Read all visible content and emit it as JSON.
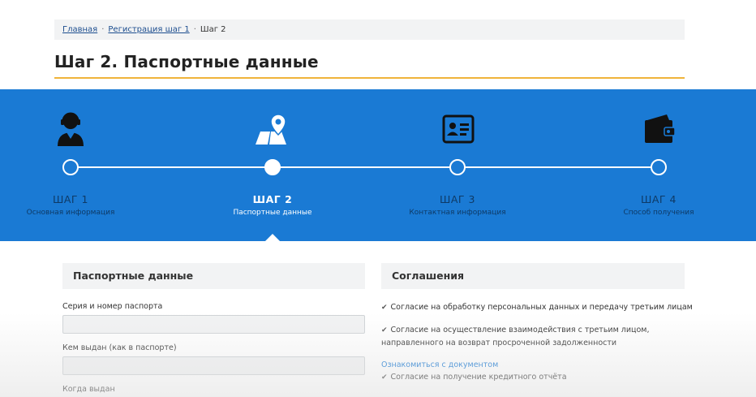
{
  "breadcrumb": {
    "home": "Главная",
    "sep": "·",
    "step1": "Регистрация шаг 1",
    "current": "Шаг 2"
  },
  "page": {
    "title": "Шаг 2. Паспортные данные"
  },
  "steps": [
    {
      "num": "ШАГ 1",
      "label": "Основная информация",
      "icon": "user-operator-icon",
      "active": false
    },
    {
      "num": "ШАГ 2",
      "label": "Паспортные данные",
      "icon": "map-pin-icon",
      "active": true
    },
    {
      "num": "ШАГ 3",
      "label": "Контактная информация",
      "icon": "id-card-icon",
      "active": false
    },
    {
      "num": "ШАГ 4",
      "label": "Способ получения",
      "icon": "wallet-icon",
      "active": false
    }
  ],
  "passport": {
    "heading": "Паспортные данные",
    "series_label": "Серия и номер паспорта",
    "issued_by_label": "Кем выдан (как в паспорте)",
    "issued_when_label": "Когда выдан"
  },
  "agreements": {
    "heading": "Соглашения",
    "consent1": "Согласие на обработку персональных данных и передачу третьим лицам",
    "consent2_line1": "Согласие на осуществление взаимодействия с третьим лицом,",
    "consent2_line2": "направленного на возврат просроченной задолженности",
    "doc_link": "Ознакомиться с документом",
    "consent3": "Согласие на получение кредитного отчёта"
  },
  "colors": {
    "accent": "#1a7ad4",
    "title_underline": "#f0b43a",
    "inactive_step_text": "#0e3a66"
  }
}
